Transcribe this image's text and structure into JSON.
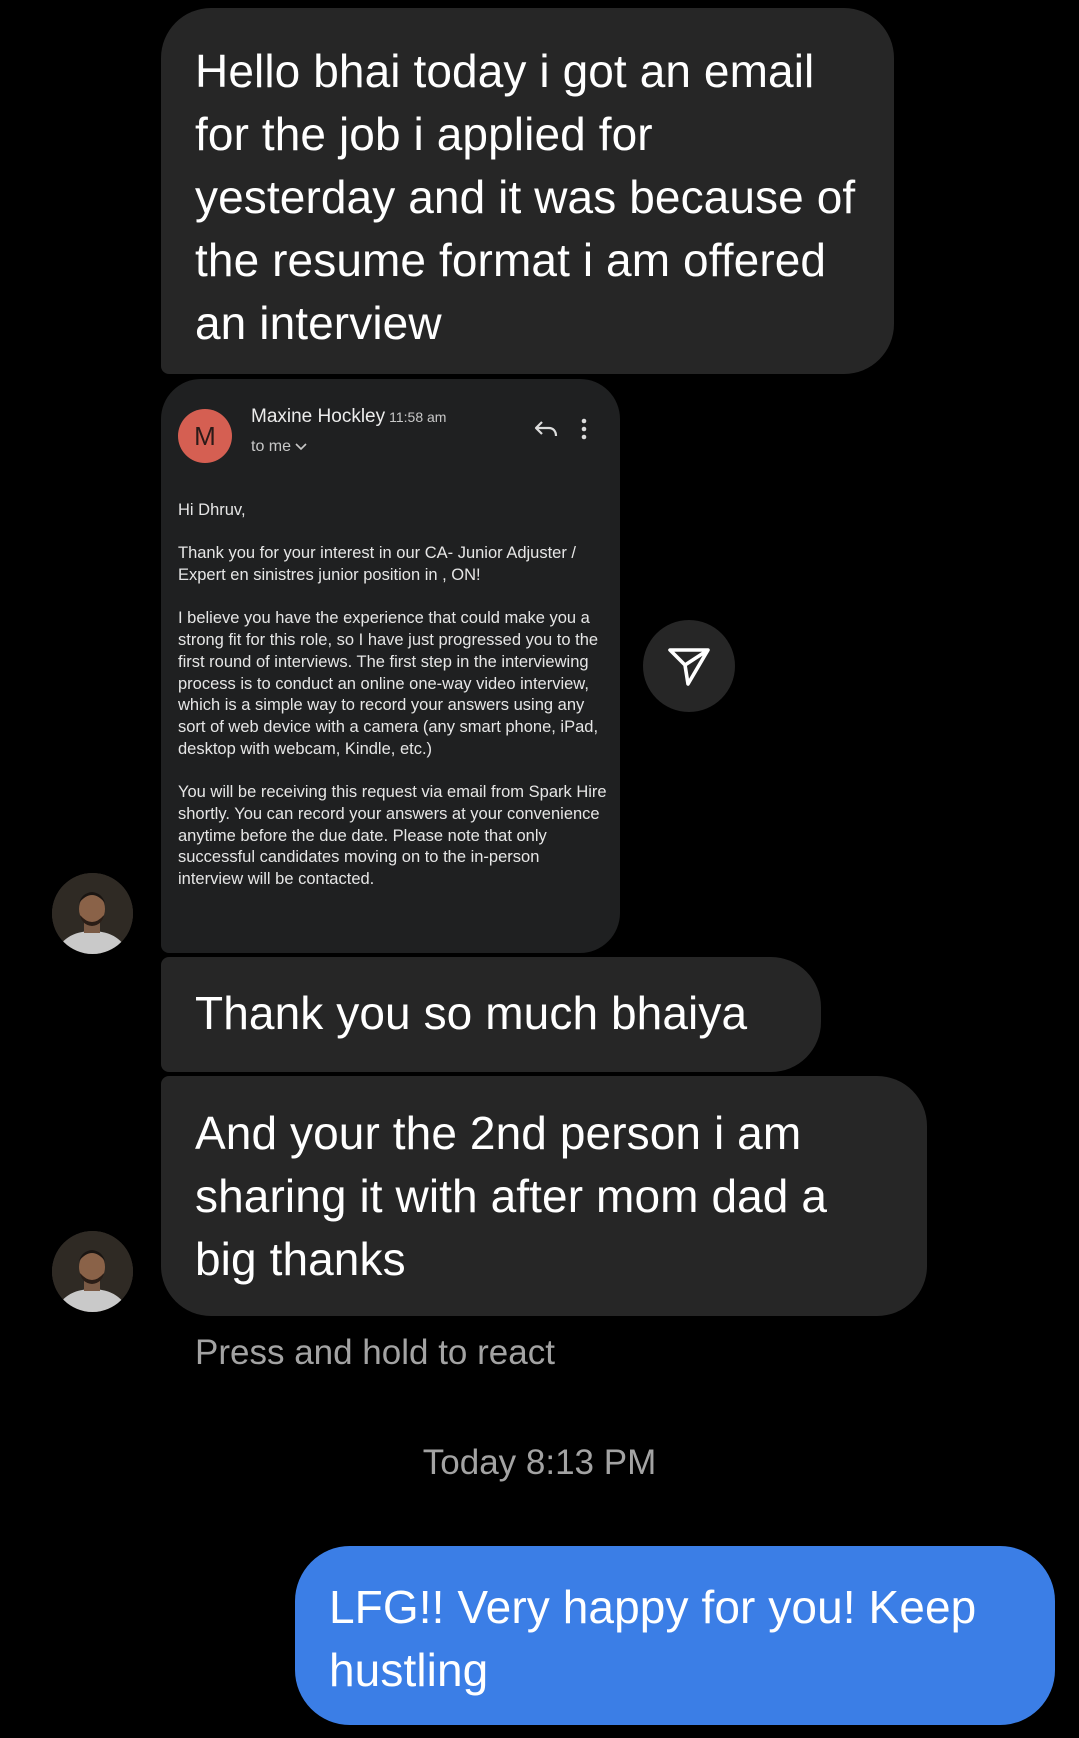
{
  "messages": {
    "m1": "Hello bhai today i got an email for the job i applied for yesterday and it was because of the resume format i am offered an interview",
    "m2": "Thank you so much bhaiya",
    "m3": "And your the 2nd person i am sharing it with after mom dad a big thanks",
    "m4": "LFG!! Very happy for you! Keep hustling"
  },
  "email": {
    "avatar_letter": "M",
    "sender": "Maxine Hockley",
    "time": "11:58 am",
    "to": "to me",
    "greeting": "Hi Dhruv,",
    "p1": "Thank you for your interest in our CA- Junior Adjuster / Expert en sinistres junior position in , ON!",
    "p2": "I believe you have the experience that could make you a strong fit for this role, so I have just progressed you to the first round of interviews. The first step in the interviewing process is to conduct an online one-way video interview, which is a simple way to record your answers using any sort of web device with a camera (any smart phone, iPad, desktop with webcam, Kindle, etc.)",
    "p3": "You will be receiving this request via email from Spark Hire shortly. You can record your answers at your convenience anytime before the due date. Please note that only successful candidates moving on to the in-person interview will be contacted."
  },
  "hint": "Press and hold to react",
  "timestamp": "Today 8:13 PM",
  "colors": {
    "incoming": "#262626",
    "outgoing": "#3b7ee6",
    "email_avatar": "#d55f52"
  }
}
